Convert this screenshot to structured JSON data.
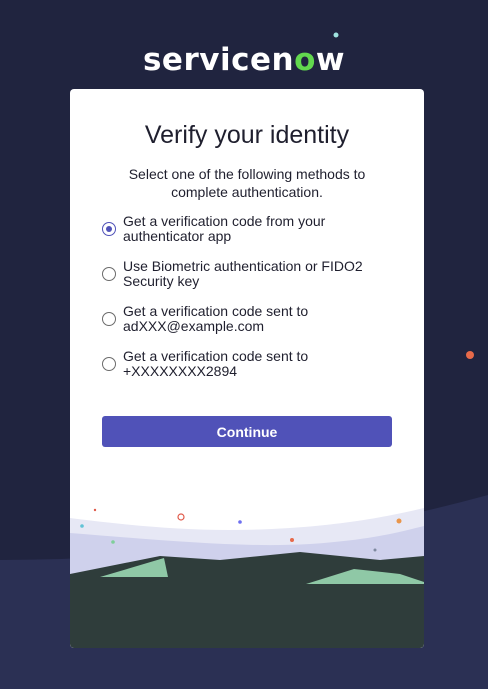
{
  "brand": {
    "logo_before": "servicen",
    "logo_mark": "o",
    "logo_after": "w"
  },
  "card": {
    "title": "Verify your identity",
    "subtitle": "Select one of the following methods to complete authentication.",
    "options": [
      {
        "label": "Get a verification code from your authenticator app",
        "selected": true
      },
      {
        "label": "Use Biometric authentication or FIDO2 Security key",
        "selected": false
      },
      {
        "label": "Get a verification code sent to adXXX@example.com",
        "selected": false
      },
      {
        "label": "Get a verification code sent to +XXXXXXXX2894",
        "selected": false
      }
    ],
    "continue_label": "Continue"
  },
  "colors": {
    "background": "#20243f",
    "accent": "#5052b8",
    "logo_mark": "#62d84e"
  }
}
